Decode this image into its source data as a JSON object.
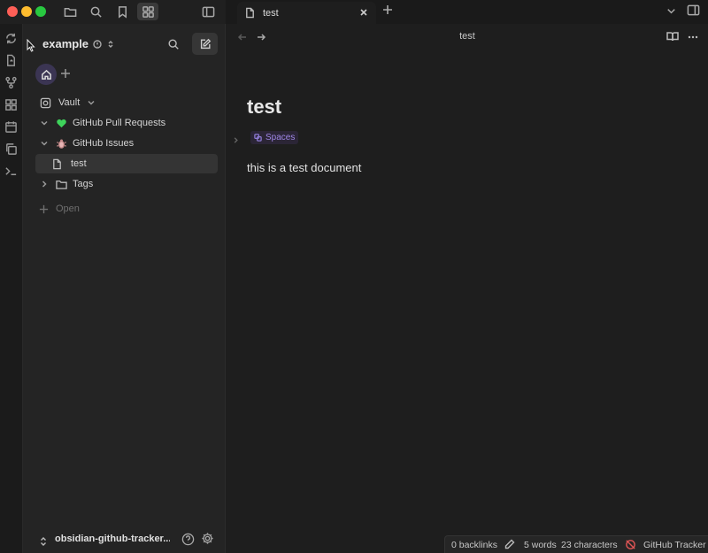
{
  "tab": {
    "title": "test"
  },
  "sidebar": {
    "vault_name": "example",
    "tree": [
      {
        "label": "Vault",
        "icon": "vault-icon"
      },
      {
        "label": "GitHub Pull Requests",
        "icon": "green-heart-emoji"
      },
      {
        "label": "GitHub Issues",
        "icon": "bug-emoji"
      },
      {
        "label": "test",
        "icon": "file-icon"
      },
      {
        "label": "Tags",
        "icon": "folder-icon"
      }
    ],
    "open_label": "Open",
    "footer_vault": "obsidian-github-tracker..."
  },
  "main": {
    "view_title": "test",
    "doc_title": "test",
    "property_tag": "Spaces",
    "body": "this is a test document"
  },
  "statusbar": {
    "backlinks": "0 backlinks",
    "words": "5 words",
    "characters": "23 characters",
    "plugin": "GitHub Tracker"
  },
  "colors": {
    "accent": "#3b3553",
    "tag_text": "#9f86e6",
    "plugin_icon": "#e05555"
  }
}
